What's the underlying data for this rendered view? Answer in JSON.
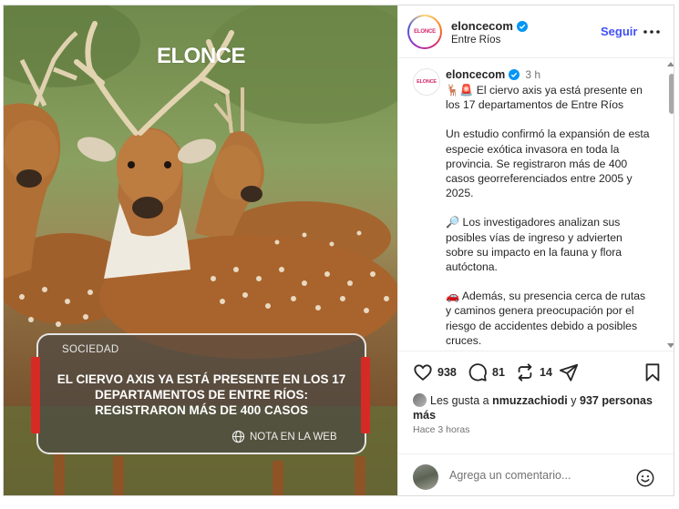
{
  "media": {
    "brand_logo": "ELONCE",
    "card": {
      "section": "SOCIEDAD",
      "headline": "EL CIERVO AXIS YA ESTÁ PRESENTE EN LOS 17 DEPARTAMENTOS DE ENTRE RÍOS: REGISTRARON MÁS DE 400 CASOS",
      "link_label": "NOTA EN LA WEB",
      "accent_color": "#d62b25"
    }
  },
  "header": {
    "avatar_text": "ELONCE",
    "username": "eloncecom",
    "location": "Entre Ríos",
    "follow_label": "Seguir",
    "more_icon": "more-horizontal-icon"
  },
  "caption": {
    "avatar_text": "ELONCE",
    "username": "eloncecom",
    "time": "3 h",
    "paragraphs": [
      "🦌🚨 El ciervo axis ya está presente en los 17 departamentos de Entre Ríos",
      "Un estudio confirmó la expansión de esta especie exótica invasora en toda la provincia. Se registraron más de 400 casos georreferenciados entre 2005 y 2025.",
      "🔎 Los investigadores analizan sus posibles vías de ingreso y advierten sobre su impacto en la fauna y flora autóctona.",
      "🚗 Además, su presencia cerca de rutas y caminos genera preocupación por el riesgo de accidentes debido a posibles cruces."
    ]
  },
  "actions": {
    "like_count": "938",
    "comment_count": "81",
    "repost_count": "14"
  },
  "likes": {
    "prefix": "Les gusta a",
    "user": "nmuzzachiodi",
    "joiner": "y",
    "others": "937 personas más"
  },
  "time_ago": "Hace 3 horas",
  "comment": {
    "placeholder": "Agrega un comentario..."
  },
  "colors": {
    "link_blue": "#4150f7",
    "verified_blue": "#0095f6",
    "text": "#262626",
    "muted": "#737373"
  }
}
